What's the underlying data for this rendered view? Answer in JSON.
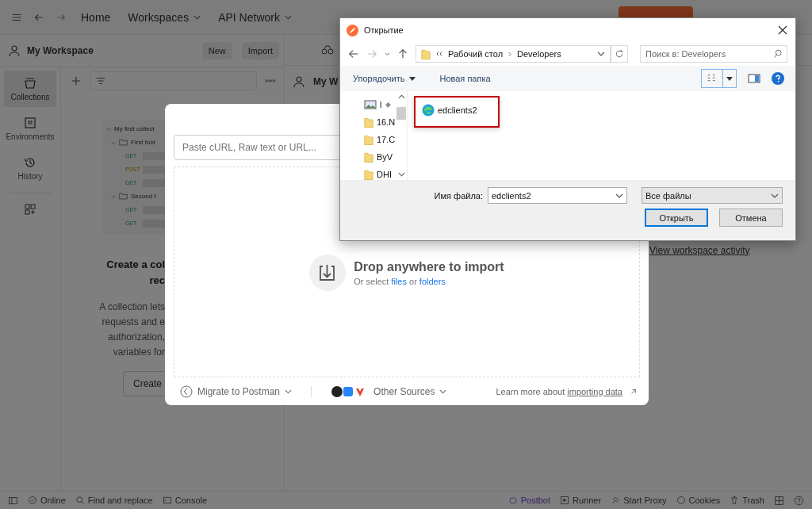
{
  "topbar": {
    "nav": [
      {
        "label": "Home",
        "dropdown": false
      },
      {
        "label": "Workspaces",
        "dropdown": true
      },
      {
        "label": "API Network",
        "dropdown": true
      }
    ]
  },
  "workspace": {
    "name": "My Workspace",
    "buttons": [
      "New",
      "Import"
    ]
  },
  "rail": [
    {
      "label": "Collections",
      "kind": "collections",
      "selected": true
    },
    {
      "label": "Environments",
      "kind": "environments",
      "selected": false
    },
    {
      "label": "History",
      "kind": "history",
      "selected": false
    }
  ],
  "preview": {
    "collection": "My first collect",
    "folders": [
      {
        "name": "First fold",
        "methods": [
          "GET",
          "POST",
          "GET"
        ]
      },
      {
        "name": "Second f",
        "methods": [
          "GET",
          "GET"
        ]
      }
    ]
  },
  "empty": {
    "title_lines": [
      "Create a col",
      "rec"
    ],
    "body_lines": [
      "A collection lets",
      "requests and e",
      "authorization,",
      "variables for"
    ],
    "button": "Create"
  },
  "workspace_tab": "My W",
  "activity_link": "View workspace activity",
  "status_left": [
    {
      "label": "Online",
      "kind": "check"
    },
    {
      "label": "Find and replace",
      "kind": "search"
    },
    {
      "label": "Console",
      "kind": "console"
    }
  ],
  "status_right": [
    {
      "label": "Postbot",
      "kind": "bot"
    },
    {
      "label": "Runner",
      "kind": "play"
    },
    {
      "label": "Start Proxy",
      "kind": "proxy"
    },
    {
      "label": "Cookies",
      "kind": "cookie"
    },
    {
      "label": "Trash",
      "kind": "trash"
    }
  ],
  "import_modal": {
    "placeholder": "Paste cURL, Raw text or URL...",
    "drop_title": "Drop anywhere to import",
    "drop_sub": [
      {
        "text": "Or select",
        "link": false
      },
      {
        "text": "files",
        "link": true
      },
      {
        "text": "or",
        "link": false
      },
      {
        "text": "folders",
        "link": true
      }
    ],
    "migrate": "Migrate to Postman",
    "other_sources": "Other Sources",
    "learn_prefix": "Learn more about",
    "learn_link": "importing data"
  },
  "file_dialog": {
    "title": "Открытие",
    "path": [
      "Рабочий стол",
      "Developers"
    ],
    "search_placeholder": "Поиск в: Developers",
    "organize": "Упорядочить",
    "new_folder": "Новая папка",
    "tree": [
      {
        "label": "l",
        "kind": "pictures"
      },
      {
        "label": "16.N",
        "kind": "folder"
      },
      {
        "label": "17.C",
        "kind": "folder"
      },
      {
        "label": "ByV",
        "kind": "folder"
      },
      {
        "label": "DHI",
        "kind": "folder"
      }
    ],
    "files": [
      {
        "name": "edclients2",
        "highlighted": true
      }
    ],
    "filename_label": "Имя файла:",
    "filename": "edclients2",
    "filetype": "Все файлы",
    "buttons": [
      {
        "label": "Открыть",
        "default": true
      },
      {
        "label": "Отмена",
        "default": false
      }
    ]
  }
}
